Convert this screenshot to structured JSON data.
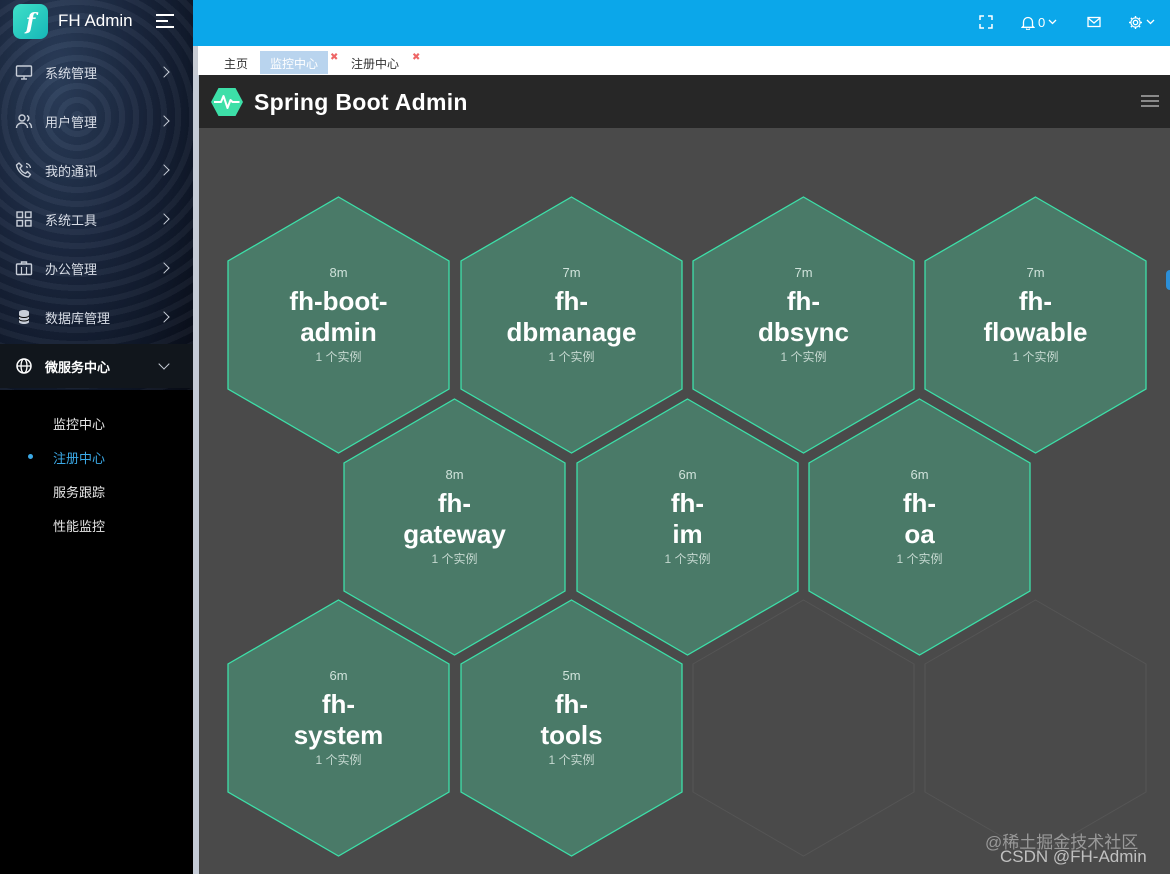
{
  "brand": {
    "name": "FH Admin",
    "logo_letter": "f"
  },
  "sidebar": {
    "items": [
      {
        "label": "系统管理",
        "icon": "monitor-icon"
      },
      {
        "label": "用户管理",
        "icon": "users-icon"
      },
      {
        "label": "我的通讯",
        "icon": "phone-icon"
      },
      {
        "label": "系统工具",
        "icon": "grid-icon"
      },
      {
        "label": "办公管理",
        "icon": "briefcase-icon"
      },
      {
        "label": "数据库管理",
        "icon": "database-icon"
      },
      {
        "label": "微服务中心",
        "icon": "globe-icon"
      }
    ],
    "subitems": [
      {
        "label": "监控中心"
      },
      {
        "label": "注册中心"
      },
      {
        "label": "服务跟踪"
      },
      {
        "label": "性能监控"
      }
    ]
  },
  "topbar": {
    "notifications": "0"
  },
  "tabs": [
    {
      "label": "主页"
    },
    {
      "label": "监控中心"
    },
    {
      "label": "注册中心"
    }
  ],
  "sba": {
    "title": "Spring Boot Admin",
    "apps": [
      {
        "age": "8m",
        "name1": "fh-boot-",
        "name2": "admin",
        "instances": "1 个实例"
      },
      {
        "age": "7m",
        "name1": "fh-",
        "name2": "dbmanage",
        "instances": "1 个实例"
      },
      {
        "age": "7m",
        "name1": "fh-",
        "name2": "dbsync",
        "instances": "1 个实例"
      },
      {
        "age": "7m",
        "name1": "fh-",
        "name2": "flowable",
        "instances": "1 个实例"
      },
      {
        "age": "8m",
        "name1": "fh-",
        "name2": "gateway",
        "instances": "1 个实例"
      },
      {
        "age": "6m",
        "name1": "fh-",
        "name2": "im",
        "instances": "1 个实例"
      },
      {
        "age": "6m",
        "name1": "fh-",
        "name2": "oa",
        "instances": "1 个实例"
      },
      {
        "age": "6m",
        "name1": "fh-",
        "name2": "system",
        "instances": "1 个实例"
      },
      {
        "age": "5m",
        "name1": "fh-",
        "name2": "tools",
        "instances": "1 个实例"
      }
    ]
  },
  "watermark": {
    "line1": "@稀土掘金技术社区",
    "line2": "CSDN @FH-Admin"
  },
  "colors": {
    "topbar": "#0ba7ea",
    "hex_fill": "#4a7a68",
    "hex_stroke": "#3ddfa8",
    "accent": "#3ba9e6"
  }
}
